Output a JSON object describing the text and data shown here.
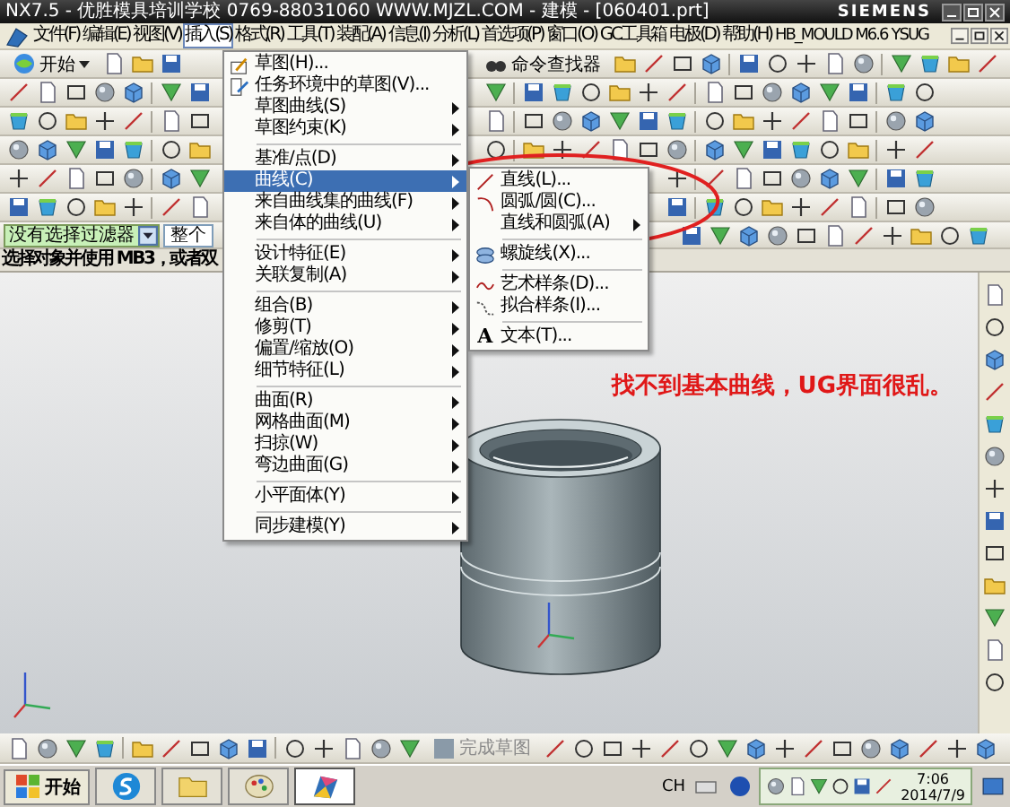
{
  "window": {
    "title": "NX7.5 - 优胜模具培训学校  0769-88031060  WWW.MJZL.COM - 建模 - [060401.prt]",
    "brand": "SIEMENS"
  },
  "menu_bar": [
    {
      "label": "文件(F)",
      "selected": false
    },
    {
      "label": "编辑(E)",
      "selected": false
    },
    {
      "label": "视图(V)",
      "selected": false
    },
    {
      "label": "插入(S)",
      "selected": true
    },
    {
      "label": "格式(R)",
      "selected": false
    },
    {
      "label": "工具(T)",
      "selected": false
    },
    {
      "label": "装配(A)",
      "selected": false
    },
    {
      "label": "信息(I)",
      "selected": false
    },
    {
      "label": "分析(L)",
      "selected": false
    },
    {
      "label": "首选项(P)",
      "selected": false
    },
    {
      "label": "窗口(O)",
      "selected": false
    },
    {
      "label": "GC工具箱",
      "selected": false
    },
    {
      "label": "电极(D)",
      "selected": false
    },
    {
      "label": "帮助(H)",
      "selected": false
    },
    {
      "label": "HB_MOULD M6.6",
      "selected": false
    },
    {
      "label": "YSUG",
      "selected": false
    }
  ],
  "toolbar": {
    "start_button": "开始",
    "command_finder": "命令查找器"
  },
  "insert_menu": {
    "groups": [
      [
        {
          "kind": "sketch",
          "label": "草图(H)...",
          "submenu": false,
          "selected": false
        },
        {
          "kind": "task-sketch",
          "label": "任务环境中的草图(V)...",
          "submenu": false,
          "selected": false
        },
        {
          "kind": "plain",
          "label": "草图曲线(S)",
          "submenu": true,
          "selected": false
        },
        {
          "kind": "plain",
          "label": "草图约束(K)",
          "submenu": true,
          "selected": false
        }
      ],
      [
        {
          "kind": "plain",
          "label": "基准/点(D)",
          "submenu": true,
          "selected": false
        },
        {
          "kind": "plain",
          "label": "曲线(C)",
          "submenu": true,
          "selected": true
        },
        {
          "kind": "plain",
          "label": "来自曲线集的曲线(F)",
          "submenu": true,
          "selected": false
        },
        {
          "kind": "plain",
          "label": "来自体的曲线(U)",
          "submenu": true,
          "selected": false
        }
      ],
      [
        {
          "kind": "plain",
          "label": "设计特征(E)",
          "submenu": true,
          "selected": false
        },
        {
          "kind": "plain",
          "label": "关联复制(A)",
          "submenu": true,
          "selected": false
        }
      ],
      [
        {
          "kind": "plain",
          "label": "组合(B)",
          "submenu": true,
          "selected": false
        },
        {
          "kind": "plain",
          "label": "修剪(T)",
          "submenu": true,
          "selected": false
        },
        {
          "kind": "plain",
          "label": "偏置/缩放(O)",
          "submenu": true,
          "selected": false
        },
        {
          "kind": "plain",
          "label": "细节特征(L)",
          "submenu": true,
          "selected": false
        }
      ],
      [
        {
          "kind": "plain",
          "label": "曲面(R)",
          "submenu": true,
          "selected": false
        },
        {
          "kind": "plain",
          "label": "网格曲面(M)",
          "submenu": true,
          "selected": false
        },
        {
          "kind": "plain",
          "label": "扫掠(W)",
          "submenu": true,
          "selected": false
        },
        {
          "kind": "plain",
          "label": "弯边曲面(G)",
          "submenu": true,
          "selected": false
        }
      ],
      [
        {
          "kind": "plain",
          "label": "小平面体(Y)",
          "submenu": true,
          "selected": false
        }
      ],
      [
        {
          "kind": "plain",
          "label": "同步建模(Y)",
          "submenu": true,
          "selected": false
        }
      ]
    ]
  },
  "curve_submenu": {
    "groups": [
      [
        {
          "kind": "line",
          "label": "直线(L)...",
          "submenu": false,
          "selected": false
        },
        {
          "kind": "arc",
          "label": "圆弧/圆(C)...",
          "submenu": false,
          "selected": false
        },
        {
          "kind": "plain",
          "label": "直线和圆弧(A)",
          "submenu": true,
          "selected": false
        }
      ],
      [
        {
          "kind": "helix",
          "label": "螺旋线(X)...",
          "submenu": false,
          "selected": false
        }
      ],
      [
        {
          "kind": "spline",
          "label": "艺术样条(D)...",
          "submenu": false,
          "selected": false
        },
        {
          "kind": "fit",
          "label": "拟合样条(I)...",
          "submenu": false,
          "selected": false
        }
      ],
      [
        {
          "kind": "text",
          "icon_text": "A",
          "label": "文本(T)...",
          "submenu": false,
          "selected": false
        }
      ]
    ]
  },
  "selection_bar": {
    "filter": "没有选择过滤器",
    "scope": "整个"
  },
  "status_text": "选择对象并使用 MB3，或者双",
  "annotation": "找不到基本曲线，UG界面很乱。",
  "sketch_toolbar": {
    "finish_sketch": "完成草图",
    "disabled": true
  },
  "taskbar": {
    "start_label": "开始",
    "apps": [
      {
        "kind": "browser",
        "selected": false
      },
      {
        "kind": "folder",
        "selected": false
      },
      {
        "kind": "paint",
        "selected": false
      },
      {
        "kind": "nx",
        "selected": true
      }
    ],
    "language": "CH",
    "time": "7:06",
    "date": "2014/7/9"
  }
}
